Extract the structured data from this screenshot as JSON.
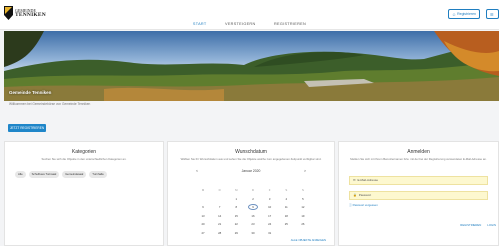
{
  "header": {
    "logo_small": "GEMEINDE",
    "logo_big": "TENNIKEN",
    "nav": [
      "START",
      "VERSTEIGERN",
      "REGISTRIEREN"
    ],
    "btn_register": "Registrieren",
    "btn_login": "Login"
  },
  "hero": {
    "title": "Gemeinde Tenniken",
    "subtitle": "Willkommen bei Gemeindebörse von Gemeinde Tenniken",
    "cta": "JETZT REGISTRIEREN"
  },
  "categories": {
    "title": "Kategorien",
    "text": "Suchen Sie sich die Objekte in den unterschiedlichen Kategorien an.",
    "chips": [
      "Alle",
      "Schulhaus Turnsaal",
      "Gemeindesaal",
      "Turnhalle"
    ]
  },
  "calendar": {
    "title": "Wunschdatum",
    "text": "Wählen Sie Ihr Wunschdatum aus und sehen Sie die Objekte welche zum angegebenen Zeitpunkt verfügbar sind.",
    "month": "Januar 2020",
    "prev": "<",
    "next": ">",
    "dow": [
      "M",
      "D",
      "M",
      "D",
      "F",
      "S",
      "S"
    ],
    "weeks": [
      [
        "",
        "",
        "1",
        "2",
        "3",
        "4",
        "5"
      ],
      [
        "6",
        "7",
        "8",
        "9",
        "10",
        "11",
        "12"
      ],
      [
        "13",
        "14",
        "15",
        "16",
        "17",
        "18",
        "19"
      ],
      [
        "20",
        "21",
        "22",
        "23",
        "24",
        "25",
        "26"
      ],
      [
        "27",
        "28",
        "29",
        "30",
        "31",
        "",
        ""
      ]
    ],
    "today": "9",
    "more": "ALLE OBJEKTE ANZEIGEN"
  },
  "login": {
    "title": "Anmelden",
    "text": "Melden Sie sich mit Ihrem Benutzernamen bzw. mit der bei der Registrierung verwendeten E-Mail-Adresse an.",
    "email_placeholder": "E-Mail-Adresse",
    "password_placeholder": "Passwort",
    "forgot": "Passwort vergessen",
    "register": "REGISTRIEREN",
    "login": "LOGIN"
  }
}
